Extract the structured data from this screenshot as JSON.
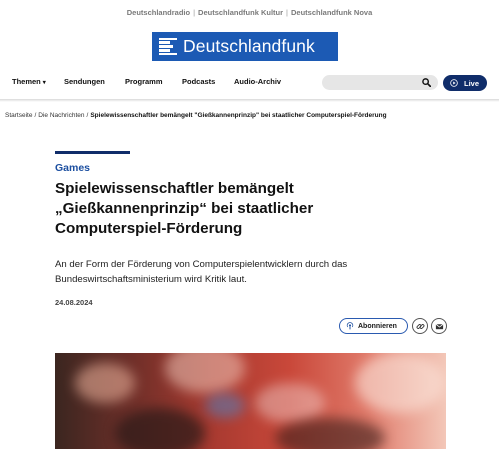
{
  "network": {
    "links": [
      "Deutschlandradio",
      "Deutschlandfunk Kultur",
      "Deutschlandfunk Nova"
    ],
    "separator": "|"
  },
  "logo": {
    "text": "Deutschlandfunk",
    "color": "#1c5ab4"
  },
  "nav": {
    "items": [
      "Themen",
      "Sendungen",
      "Programm",
      "Podcasts",
      "Audio-Archiv"
    ],
    "themen_chevron": "chevron-down-icon",
    "search_placeholder": "",
    "live_label": "Live"
  },
  "breadcrumb": {
    "items": [
      "Startseite",
      "Die Nachrichten"
    ],
    "current": "Spielewissenschaftler bemängelt \"Gießkannenprinzip\" bei staatlicher Computerspiel-Förderung",
    "separator": "/"
  },
  "article": {
    "kicker": "Games",
    "headline": "Spielewissenschaftler bemängelt „Gießkannenprinzip“ bei staatlicher Computerspiel-Förderung",
    "teaser": "An der Form der Förderung von Computerspielentwicklern durch das Bundeswirtschaftsministerium wird Kritik laut.",
    "date": "24.08.2024",
    "subscribe_label": "Abonnieren",
    "accent_color": "#102d6a",
    "kicker_color": "#1c4fa0"
  },
  "icons": {
    "search": "search-icon",
    "live": "play-circle-icon",
    "subscribe": "podcast-icon",
    "share_link": "link-icon",
    "share_mail": "mail-icon"
  }
}
